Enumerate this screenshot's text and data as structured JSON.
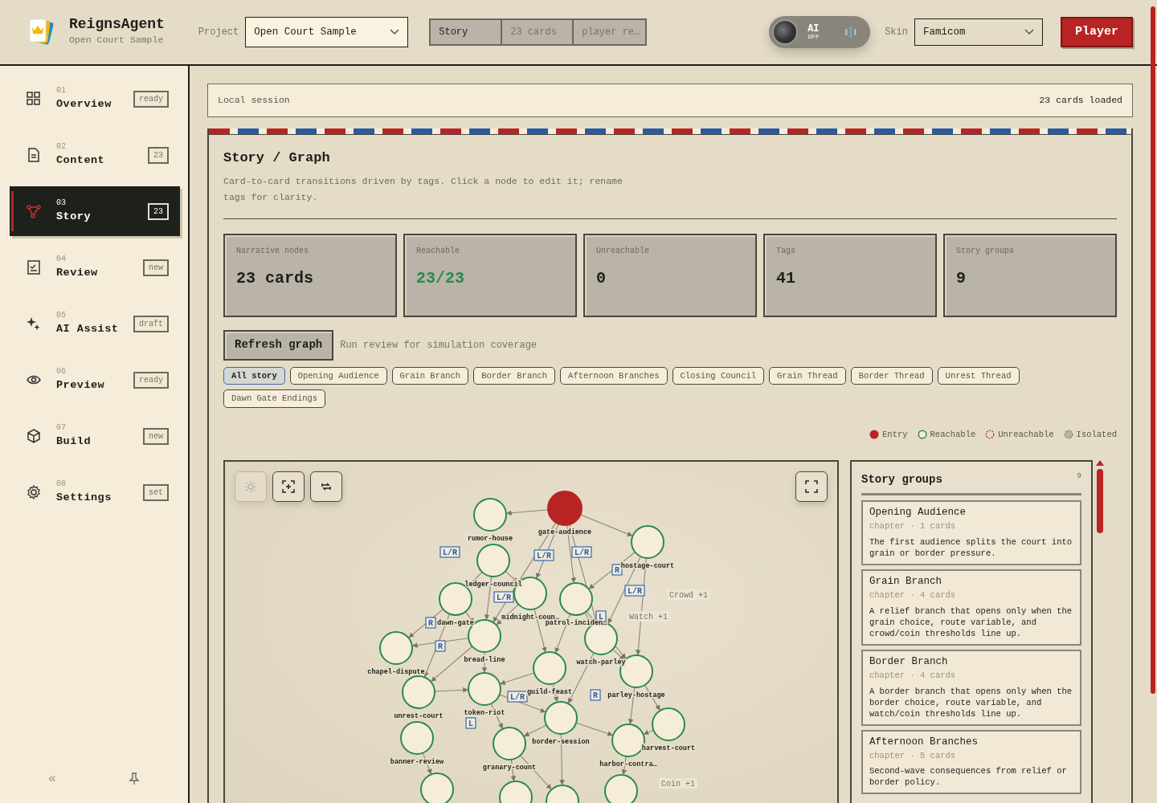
{
  "app": {
    "name": "ReignsAgent",
    "subtitle": "Open Court Sample"
  },
  "project": {
    "label": "Project",
    "value": "Open Court Sample"
  },
  "breadcrumb": [
    {
      "label": "Story",
      "selected": true
    },
    {
      "label": "23 cards",
      "selected": false
    },
    {
      "label": "player re…",
      "selected": false
    }
  ],
  "ai_toggle": {
    "label": "AI",
    "state": "OFF",
    "on": false
  },
  "skin": {
    "label": "Skin",
    "value": "Famicom"
  },
  "player_button": "Player",
  "sidebar": {
    "items": [
      {
        "number": "01",
        "label": "Overview",
        "badge": "ready",
        "kind": "grid",
        "selected": false
      },
      {
        "number": "02",
        "label": "Content",
        "badge": "23",
        "kind": "file",
        "selected": false
      },
      {
        "number": "03",
        "label": "Story",
        "badge": "23",
        "kind": "graph",
        "selected": true
      },
      {
        "number": "04",
        "label": "Review",
        "badge": "new",
        "kind": "check",
        "selected": false
      },
      {
        "number": "05",
        "label": "AI Assist",
        "badge": "draft",
        "kind": "sparkle",
        "selected": false
      },
      {
        "number": "06",
        "label": "Preview",
        "badge": "ready",
        "kind": "eye",
        "selected": false
      },
      {
        "number": "07",
        "label": "Build",
        "badge": "new",
        "kind": "box",
        "selected": false
      },
      {
        "number": "08",
        "label": "Settings",
        "badge": "set",
        "kind": "gear",
        "selected": false
      }
    ],
    "collapse": "«"
  },
  "session": {
    "label": "Local session",
    "status": "23 cards loaded"
  },
  "panel": {
    "title": "Story / Graph",
    "description": "Card-to-card transitions driven by tags. Click a node to edit it; rename tags for clarity.",
    "stats": [
      {
        "label": "Narrative nodes",
        "value": "23 cards",
        "kind": "plain"
      },
      {
        "label": "Reachable",
        "value": "23/23",
        "kind": "good"
      },
      {
        "label": "Unreachable",
        "value": "0",
        "kind": "plain"
      },
      {
        "label": "Tags",
        "value": "41",
        "kind": "plain"
      },
      {
        "label": "Story groups",
        "value": "9",
        "kind": "plain"
      }
    ],
    "refresh_button": "Refresh graph",
    "refresh_note": "Run review for simulation coverage",
    "filters": [
      {
        "label": "All story",
        "selected": true
      },
      {
        "label": "Opening Audience",
        "selected": false
      },
      {
        "label": "Grain Branch",
        "selected": false
      },
      {
        "label": "Border Branch",
        "selected": false
      },
      {
        "label": "Afternoon Branches",
        "selected": false
      },
      {
        "label": "Closing Council",
        "selected": false
      },
      {
        "label": "Grain Thread",
        "selected": false
      },
      {
        "label": "Border Thread",
        "selected": false
      },
      {
        "label": "Unrest Thread",
        "selected": false
      },
      {
        "label": "Dawn Gate Endings",
        "selected": false
      }
    ],
    "legend": [
      {
        "label": "Entry",
        "kind": "entry"
      },
      {
        "label": "Reachable",
        "kind": "reachable"
      },
      {
        "label": "Unreachable",
        "kind": "unreachable"
      },
      {
        "label": "Isolated",
        "kind": "isolated"
      }
    ]
  },
  "graph": {
    "tools": [
      {
        "kind": "light",
        "disabled": true
      },
      {
        "kind": "fit",
        "disabled": false
      },
      {
        "kind": "swap",
        "disabled": false
      }
    ],
    "nodes": [
      {
        "label": "rumor-house",
        "kind": "reachable"
      },
      {
        "label": "gate-audience",
        "kind": "entry"
      },
      {
        "label": "hostage-court",
        "kind": "reachable"
      },
      {
        "label": "ledger-council",
        "kind": "reachable"
      },
      {
        "label": "dawn-gate",
        "kind": "reachable"
      },
      {
        "label": "midnight-coun…",
        "kind": "reachable"
      },
      {
        "label": "patrol-inciden…",
        "kind": "reachable"
      },
      {
        "label": "chapel-dispute",
        "kind": "reachable"
      },
      {
        "label": "bread-line",
        "kind": "reachable"
      },
      {
        "label": "watch-parley",
        "kind": "reachable"
      },
      {
        "label": "guild-feast",
        "kind": "reachable"
      },
      {
        "label": "parley-hostage",
        "kind": "reachable"
      },
      {
        "label": "unrest-court",
        "kind": "reachable"
      },
      {
        "label": "token-riot",
        "kind": "reachable"
      },
      {
        "label": "border-session",
        "kind": "reachable"
      },
      {
        "label": "harvest-court",
        "kind": "reachable"
      },
      {
        "label": "banner-review",
        "kind": "reachable"
      },
      {
        "label": "granary-count",
        "kind": "reachable"
      },
      {
        "label": "harbor-contra…",
        "kind": "reachable"
      }
    ],
    "tags": [
      {
        "text": "L/R",
        "kind": "choice"
      },
      {
        "text": "L/R",
        "kind": "choice"
      },
      {
        "text": "L/R",
        "kind": "choice"
      },
      {
        "text": "R",
        "kind": "choice"
      },
      {
        "text": "L/R",
        "kind": "choice"
      },
      {
        "text": "R",
        "kind": "choice"
      },
      {
        "text": "L/R",
        "kind": "choice"
      },
      {
        "text": "L",
        "kind": "choice"
      },
      {
        "text": "R",
        "kind": "choice"
      },
      {
        "text": "L/R",
        "kind": "choice"
      },
      {
        "text": "R",
        "kind": "choice"
      },
      {
        "text": "L",
        "kind": "choice"
      },
      {
        "text": "Watch +1",
        "kind": "effect"
      },
      {
        "text": "Crowd +1",
        "kind": "effect"
      },
      {
        "text": "Coin +1",
        "kind": "effect"
      }
    ]
  },
  "groups": {
    "title": "Story groups",
    "count": "9",
    "items": [
      {
        "name": "Opening Audience",
        "meta": "chapter · 1 cards",
        "description": "The first audience splits the court into grain or border pressure."
      },
      {
        "name": "Grain Branch",
        "meta": "chapter · 4 cards",
        "description": "A relief branch that opens only when the grain choice, route variable, and crowd/coin thresholds line up."
      },
      {
        "name": "Border Branch",
        "meta": "chapter · 4 cards",
        "description": "A border branch that opens only when the border choice, route variable, and watch/coin thresholds line up."
      },
      {
        "name": "Afternoon Branches",
        "meta": "chapter · 5 cards",
        "description": "Second-wave consequences from relief or border policy."
      }
    ]
  }
}
